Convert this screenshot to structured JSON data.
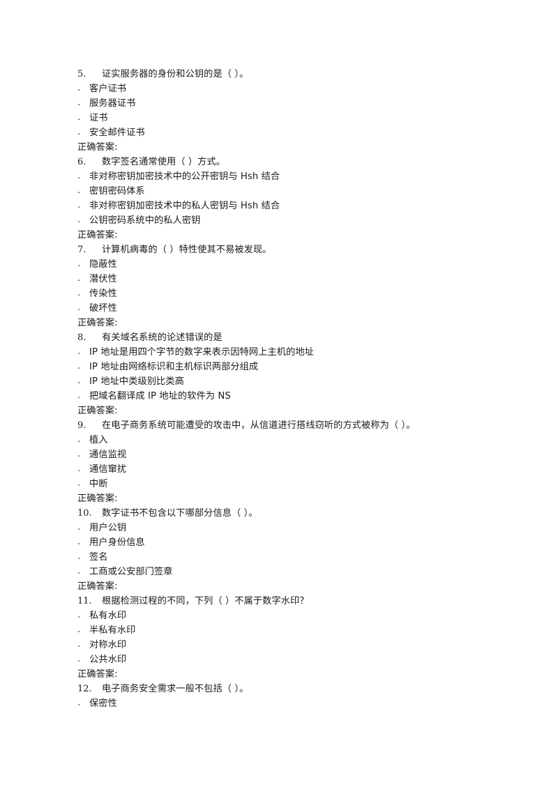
{
  "document": {
    "page_background": "#ffffff",
    "text_color": "#1a1a1a",
    "answer_label": "正确答案:",
    "option_bullet": ".",
    "questions": [
      {
        "number": "5.",
        "stem": "证实服务器的身份和公钥的是（ ）。",
        "options": [
          "客户证书",
          "服务器证书",
          "证书",
          "安全邮件证书"
        ],
        "answer_label": "正确答案:",
        "answer_value": ""
      },
      {
        "number": "6.",
        "stem": "数字签名通常使用（ ）方式。",
        "options": [
          "非对称密钥加密技术中的公开密钥与 Hsh 结合",
          "密钥密码体系",
          "非对称密钥加密技术中的私人密钥与 Hsh 结合",
          "公钥密码系统中的私人密钥"
        ],
        "answer_label": "正确答案:",
        "answer_value": ""
      },
      {
        "number": "7.",
        "stem": "计算机病毒的（ ）特性使其不易被发现。",
        "options": [
          "隐蔽性",
          "潜伏性",
          "传染性",
          "破坏性"
        ],
        "answer_label": "正确答案:",
        "answer_value": ""
      },
      {
        "number": "8.",
        "stem": "有关域名系统的论述错误的是",
        "options": [
          "IP 地址是用四个字节的数字来表示因特网上主机的地址",
          "IP 地址由网络标识和主机标识两部分组成",
          "IP 地址中类级别比类高",
          "把域名翻译成 IP 地址的软件为 NS"
        ],
        "answer_label": "正确答案:",
        "answer_value": ""
      },
      {
        "number": "9.",
        "stem": "在电子商务系统可能遭受的攻击中，从信道进行搭线窃听的方式被称为（ ）。",
        "options": [
          "植入",
          "通信监视",
          "通信窜扰",
          "中断"
        ],
        "answer_label": "正确答案:",
        "answer_value": ""
      },
      {
        "number": "10.",
        "stem": "数字证书不包含以下哪部分信息（    ）。",
        "options": [
          "用户公钥",
          "用户身份信息",
          "签名",
          "工商或公安部门签章"
        ],
        "answer_label": "正确答案:",
        "answer_value": ""
      },
      {
        "number": "11.",
        "stem": "根据检测过程的不同，下列（ ）不属于数字水印？",
        "options": [
          "私有水印",
          "半私有水印",
          "对称水印",
          "公共水印"
        ],
        "answer_label": "正确答案:",
        "answer_value": ""
      },
      {
        "number": "12.",
        "stem": "电子商务安全需求一般不包括（  ）。",
        "options": [
          "保密性"
        ],
        "answer_label": "",
        "answer_value": ""
      }
    ]
  }
}
